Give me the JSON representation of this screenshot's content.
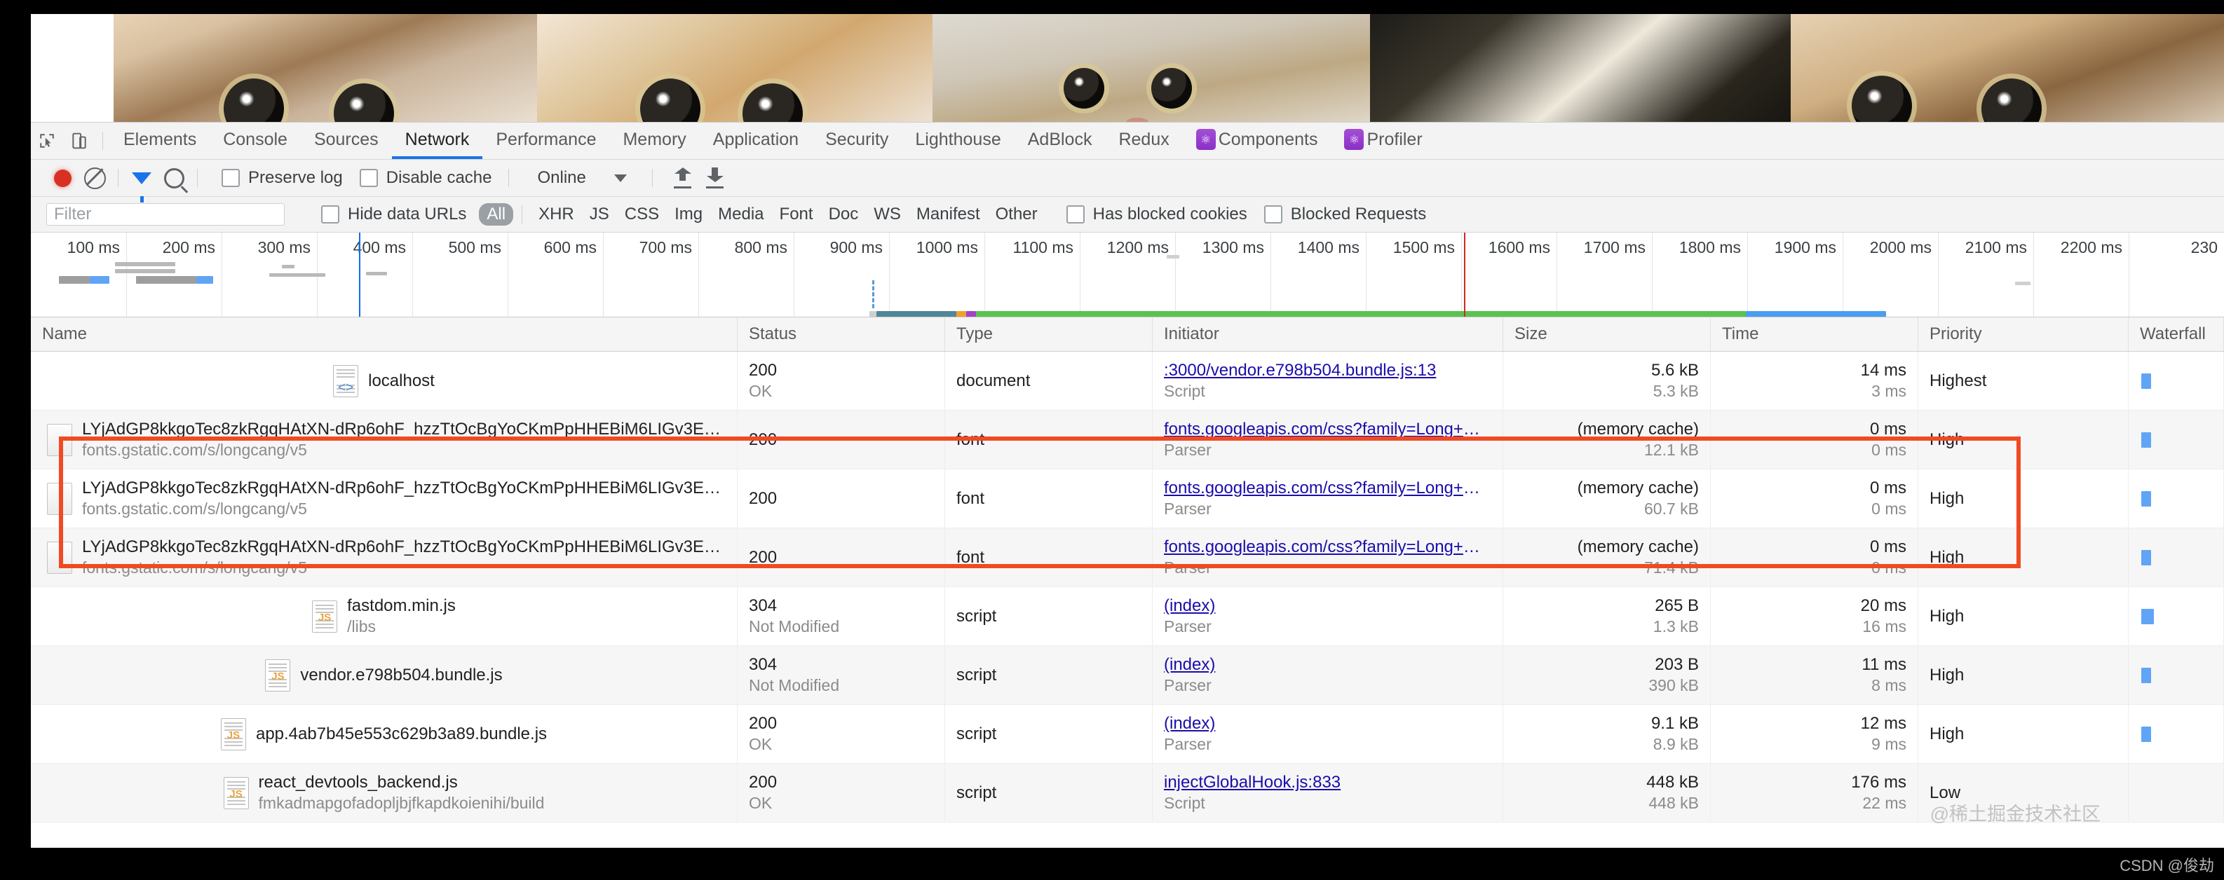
{
  "window": {
    "tabbar": {
      "inspect_icon": "inspect-element-icon",
      "device_icon": "device-toolbar-icon",
      "tabs": [
        {
          "label": "Elements",
          "active": false,
          "ext": false
        },
        {
          "label": "Console",
          "active": false,
          "ext": false
        },
        {
          "label": "Sources",
          "active": false,
          "ext": false
        },
        {
          "label": "Network",
          "active": true,
          "ext": false
        },
        {
          "label": "Performance",
          "active": false,
          "ext": false
        },
        {
          "label": "Memory",
          "active": false,
          "ext": false
        },
        {
          "label": "Application",
          "active": false,
          "ext": false
        },
        {
          "label": "Security",
          "active": false,
          "ext": false
        },
        {
          "label": "Lighthouse",
          "active": false,
          "ext": false
        },
        {
          "label": "AdBlock",
          "active": false,
          "ext": false
        },
        {
          "label": "Redux",
          "active": false,
          "ext": false
        },
        {
          "label": "Components",
          "active": false,
          "ext": true
        },
        {
          "label": "Profiler",
          "active": false,
          "ext": true
        }
      ]
    },
    "toolbar": {
      "record_icon": "record-stop-icon",
      "clear_icon": "clear-icon",
      "filter_icon": "filter-funnel-icon",
      "search_icon": "search-icon",
      "preserve_log": {
        "label": "Preserve log",
        "checked": false
      },
      "disable_cache": {
        "label": "Disable cache",
        "checked": false
      },
      "throttling": "Online",
      "throttling_caret": "chevron-down-icon",
      "import_icon": "import-har-icon",
      "export_icon": "export-har-icon"
    },
    "filterbar": {
      "filter_placeholder": "Filter",
      "filter_value": "",
      "hide_data_urls": {
        "label": "Hide data URLs",
        "checked": false
      },
      "types": [
        "All",
        "XHR",
        "JS",
        "CSS",
        "Img",
        "Media",
        "Font",
        "Doc",
        "WS",
        "Manifest",
        "Other"
      ],
      "selected_type": "All",
      "has_blocked_cookies": {
        "label": "Has blocked cookies",
        "checked": false
      },
      "blocked_requests": {
        "label": "Blocked Requests",
        "checked": false
      }
    },
    "overview": {
      "ticks": [
        "100 ms",
        "200 ms",
        "300 ms",
        "400 ms",
        "500 ms",
        "600 ms",
        "700 ms",
        "800 ms",
        "900 ms",
        "1000 ms",
        "1100 ms",
        "1200 ms",
        "1300 ms",
        "1400 ms",
        "1500 ms",
        "1600 ms",
        "1700 ms",
        "1800 ms",
        "1900 ms",
        "2000 ms",
        "2100 ms",
        "2200 ms",
        "230"
      ],
      "dom_content_loaded_color": "#0d6ee8",
      "load_event_color": "#cc2b1d"
    },
    "columns": [
      "Name",
      "Status",
      "Type",
      "Initiator",
      "Size",
      "Time",
      "Priority",
      "Waterfall"
    ],
    "rows": [
      {
        "name": "localhost",
        "sub": "",
        "status": "200",
        "status2": "OK",
        "type": "document",
        "initiator": ":3000/vendor.e798b504.bundle.js:13",
        "initiator2": "Script",
        "size": "5.6 kB",
        "size2": "5.3 kB",
        "time": "14 ms",
        "time2": "3 ms",
        "priority": "Highest",
        "icon": "document-file-icon"
      },
      {
        "name": "LYjAdGP8kkgoTec8zkRgqHAtXN-dRp6ohF_hzzTtOcBgYoCKmPpHHEBiM6LIGv3E…",
        "sub": "fonts.gstatic.com/s/longcang/v5",
        "status": "200",
        "status2": "",
        "type": "font",
        "initiator": "fonts.googleapis.com/css?family=Long+C…",
        "initiator2": "Parser",
        "size": "(memory cache)",
        "size2": "12.1 kB",
        "time": "0 ms",
        "time2": "0 ms",
        "priority": "High",
        "icon": "font-file-icon"
      },
      {
        "name": "LYjAdGP8kkgoTec8zkRgqHAtXN-dRp6ohF_hzzTtOcBgYoCKmPpHHEBiM6LIGv3E…",
        "sub": "fonts.gstatic.com/s/longcang/v5",
        "status": "200",
        "status2": "",
        "type": "font",
        "initiator": "fonts.googleapis.com/css?family=Long+C…",
        "initiator2": "Parser",
        "size": "(memory cache)",
        "size2": "60.7 kB",
        "time": "0 ms",
        "time2": "0 ms",
        "priority": "High",
        "icon": "font-file-icon"
      },
      {
        "name": "LYjAdGP8kkgoTec8zkRgqHAtXN-dRp6ohF_hzzTtOcBgYoCKmPpHHEBiM6LIGv3E…",
        "sub": "fonts.gstatic.com/s/longcang/v5",
        "status": "200",
        "status2": "",
        "type": "font",
        "initiator": "fonts.googleapis.com/css?family=Long+C…",
        "initiator2": "Parser",
        "size": "(memory cache)",
        "size2": "71.4 kB",
        "time": "0 ms",
        "time2": "0 ms",
        "priority": "High",
        "icon": "font-file-icon"
      },
      {
        "name": "fastdom.min.js",
        "sub": "/libs",
        "status": "304",
        "status2": "Not Modified",
        "type": "script",
        "initiator": "(index)",
        "initiator2": "Parser",
        "size": "265 B",
        "size2": "1.3 kB",
        "time": "20 ms",
        "time2": "16 ms",
        "priority": "High",
        "icon": "js-file-icon"
      },
      {
        "name": "vendor.e798b504.bundle.js",
        "sub": "",
        "status": "304",
        "status2": "Not Modified",
        "type": "script",
        "initiator": "(index)",
        "initiator2": "Parser",
        "size": "203 B",
        "size2": "390 kB",
        "time": "11 ms",
        "time2": "8 ms",
        "priority": "High",
        "icon": "js-file-icon"
      },
      {
        "name": "app.4ab7b45e553c629b3a89.bundle.js",
        "sub": "",
        "status": "200",
        "status2": "OK",
        "type": "script",
        "initiator": "(index)",
        "initiator2": "Parser",
        "size": "9.1 kB",
        "size2": "8.9 kB",
        "time": "12 ms",
        "time2": "9 ms",
        "priority": "High",
        "icon": "js-file-icon"
      },
      {
        "name": "react_devtools_backend.js",
        "sub": "fmkadmapgofadopljbjfkapdkoienihi/build",
        "status": "200",
        "status2": "OK",
        "type": "script",
        "initiator": "injectGlobalHook.js:833",
        "initiator2": "Script",
        "size": "448 kB",
        "size2": "448 kB",
        "time": "176 ms",
        "time2": "22 ms",
        "priority": "Low",
        "icon": "js-file-icon"
      }
    ],
    "annotation": {
      "shape": "red-rectangle",
      "color": "#f04a23"
    },
    "watermarks": {
      "primary": "@稀土掘金技术社区",
      "secondary": "CSDN @俊劫"
    }
  }
}
